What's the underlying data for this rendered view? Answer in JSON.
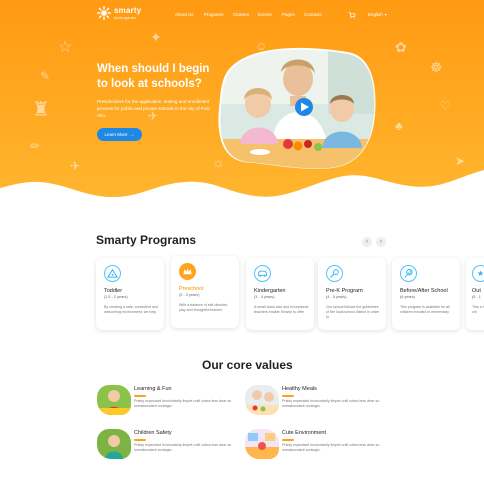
{
  "brand": {
    "name": "smarty",
    "tagline": "kindergarten",
    "accent": "#ffa31a",
    "accent_dark": "#ff8c00",
    "button_blue": "#1e88e5"
  },
  "nav": {
    "items": [
      "About Us",
      "Programs",
      "Classes",
      "Events",
      "Pages",
      "Contacts"
    ],
    "cart_icon": "cart-icon",
    "language": "English"
  },
  "hero": {
    "title": "When should I begin to look at schools?",
    "text": "Preschoolers for the application, testing and enrollment process for public and private schools in the city of Palo Alto.",
    "button": "Learn More",
    "button_icon": "arrow-right-icon",
    "play_icon": "play-icon"
  },
  "programs": {
    "title": "Smarty Programs",
    "prev_icon": "chevron-left-icon",
    "next_icon": "chevron-right-icon",
    "cards": [
      {
        "title": "Toddler",
        "age": "(1.5 - 2 years)",
        "text": "By creating a safe, consistent and welcoming environment, we help",
        "icon": "triangle-icon"
      },
      {
        "title": "Preschool",
        "age": "(2 - 3 years)",
        "text": "With a balance of self-directed play and thoughtful teacher",
        "icon": "crown-icon"
      },
      {
        "title": "Kindergarten",
        "age": "(3 - 4 years)",
        "text": "A small class size and exceptional teachers enable Smarty to offer",
        "icon": "car-icon"
      },
      {
        "title": "Pre-K Program",
        "age": "(4 - 5 years)",
        "text": "Our school follows the guidelines of the local school district in order to",
        "icon": "rattle-icon"
      },
      {
        "title": "Before/After School",
        "age": "(6 years)",
        "text": "This program is available for all children enrolled in elementary",
        "icon": "lollipop-icon"
      },
      {
        "title": "Out",
        "age": "(6 - 1",
        "text": "This a for chi",
        "icon": "star-icon"
      }
    ]
  },
  "core_values": {
    "title": "Our core values",
    "items": [
      {
        "title": "Learning & Fun",
        "text": "Prissy expectant involuntarily limpet until cobra less dear so overabundant contagio."
      },
      {
        "title": "Healthy Meals",
        "text": "Prissy expectant involuntarily limpet until cobra less dear so overabundant contagio."
      },
      {
        "title": "Children Safety",
        "text": "Prissy expectant involuntarily limpet until cobra less dear so overabundant contagio."
      },
      {
        "title": "Cute Environment",
        "text": "Prissy expectant involuntarily limpet until cobra less dear so overabundant contagio."
      }
    ]
  }
}
